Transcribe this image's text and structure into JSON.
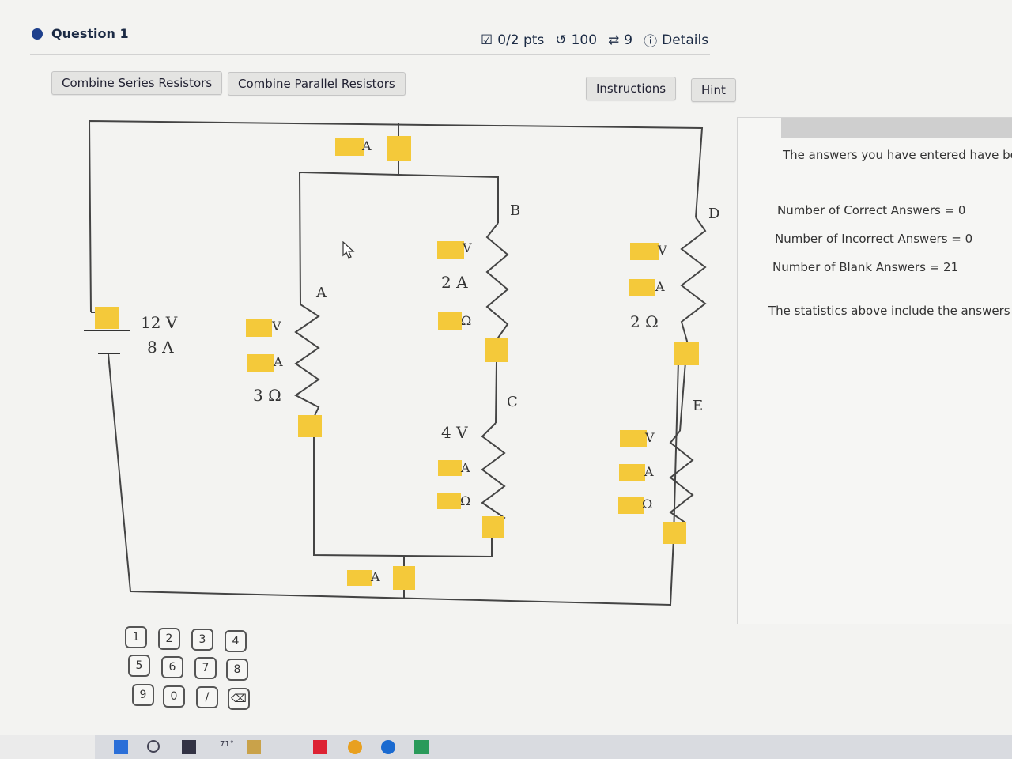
{
  "question": {
    "title": "Question 1",
    "points": "0/2 pts",
    "retries": "100",
    "attempts": "9",
    "details": "Details"
  },
  "toolbar": {
    "combine_series": "Combine Series Resistors",
    "combine_parallel": "Combine Parallel Resistors",
    "instructions": "Instructions",
    "hint": "Hint"
  },
  "circuit": {
    "battery": {
      "voltage": "12 V",
      "current": "8 A"
    },
    "nodes": {
      "a": "A",
      "b": "B",
      "c": "C",
      "d": "D",
      "e": "E"
    },
    "resistor_3": {
      "value": "3 Ω",
      "v_unit": "V",
      "a_unit": "A"
    },
    "resistor_b": {
      "current": "2 A",
      "v_unit": "V",
      "ohm_unit": "Ω"
    },
    "resistor_c": {
      "voltage": "4 V",
      "a_unit": "A",
      "ohm_unit": "Ω"
    },
    "resistor_d": {
      "value": "2 Ω",
      "v_unit": "V",
      "a_unit": "A"
    },
    "resistor_e": {
      "v_unit": "V",
      "a_unit": "A",
      "ohm_unit": "Ω"
    },
    "top_wire_unit": "A",
    "bottom_wire_unit": "A"
  },
  "feedback": {
    "line1": "The answers you have entered have be",
    "correct": "Number of Correct Answers = 0",
    "incorrect": "Number of Incorrect Answers = 0",
    "blank": "Number of Blank Answers = 21",
    "stats": "The statistics above include the answers fo"
  },
  "keypad": {
    "keys": [
      "1",
      "2",
      "3",
      "4",
      "5",
      "6",
      "7",
      "8",
      "9",
      "0",
      "/",
      "⌫"
    ]
  },
  "taskbar": {
    "weather": "71°"
  },
  "colors": {
    "input_box": "#f4c93a",
    "header_dot": "#1d3f8c"
  }
}
